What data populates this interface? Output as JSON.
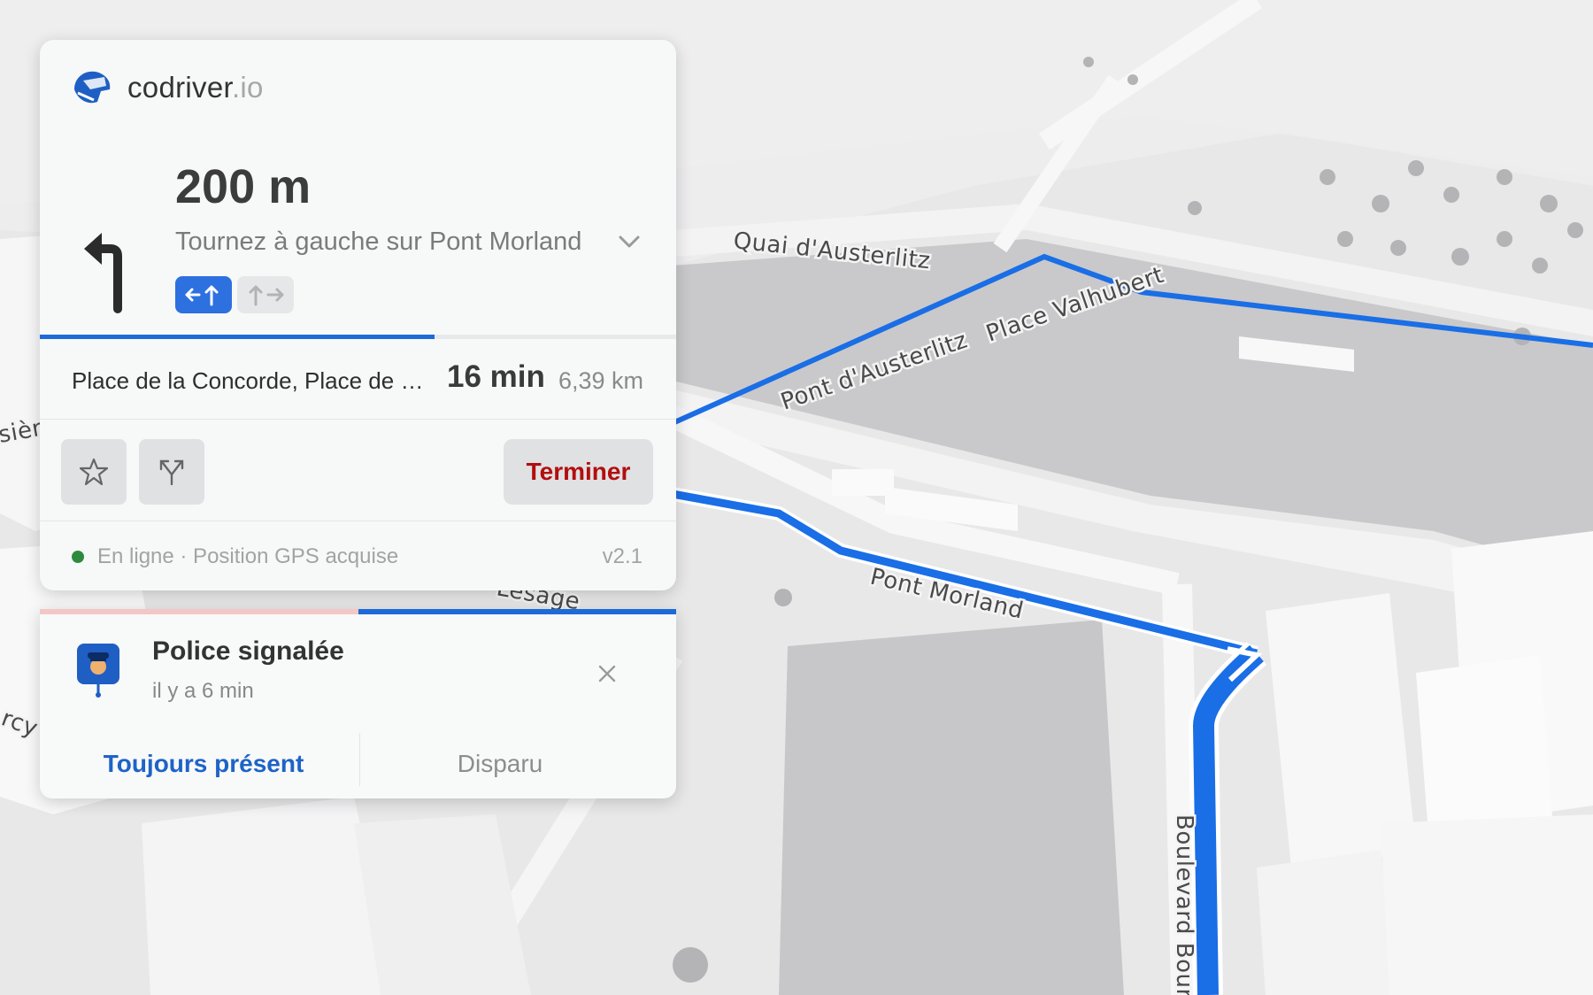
{
  "map": {
    "street_labels": [
      "Quai d'Austerlitz",
      "Place Valhubert",
      "Pont d'Austerlitz",
      "Pont Morland",
      "Boulevard Bour",
      "Lesage",
      "sièr",
      "rcy"
    ]
  },
  "brand": {
    "name": "codriver",
    "tld": ".io",
    "icon": "helmet-icon"
  },
  "maneuver": {
    "icon": "turn-left-arrow-icon",
    "distance": "200 m",
    "instruction": "Tournez à gauche sur Pont Morland",
    "progress": 0.62,
    "lanes": [
      {
        "icon": "lane-left-straight-icon",
        "active": true
      },
      {
        "icon": "lane-straight-right-icon",
        "active": false
      }
    ]
  },
  "trip": {
    "destination": "Place de la Concorde, Place de la Concorde, Paris",
    "eta": "16 min",
    "distance": "6,39 km"
  },
  "actions": {
    "favorite_icon": "star-icon",
    "route_options_icon": "route-fork-icon",
    "end_label": "Terminer",
    "end_color": "#b20e0e"
  },
  "status": {
    "text": "En ligne · Position GPS acquise",
    "version": "v2.1",
    "online_color": "#2e8b3e"
  },
  "alert": {
    "icon": "police-officer-icon",
    "title": "Police signalée",
    "time": "il y a 6 min",
    "timer_remaining": 0.5,
    "confirm_label": "Toujours présent",
    "dismiss_label": "Disparu"
  },
  "colors": {
    "accent": "#1d6ad8",
    "route": "#1a6ee6"
  }
}
